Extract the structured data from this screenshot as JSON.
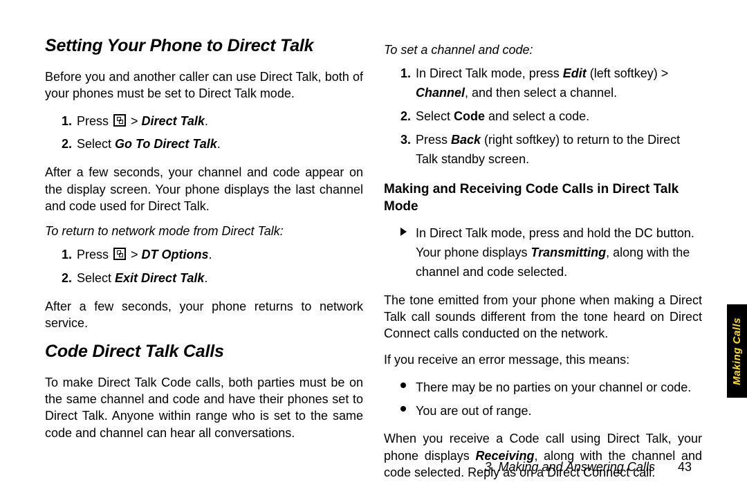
{
  "left": {
    "h1": "Setting Your Phone to Direct Talk",
    "p1": "Before you and another caller can use Direct Talk, both of your phones must be set to Direct Talk mode.",
    "step1a_pre": "Press ",
    "step1a_post": " >",
    "step1a_cmd": "Direct Talk",
    "step2a_pre": "Select ",
    "step2a_cmd": "Go To Direct Talk",
    "p2": "After a few seconds, your channel and code appear on the display screen. Your phone displays the last channel and code used for Direct Talk.",
    "sub1": "To return to network mode from Direct Talk:",
    "step1b_pre": "Press ",
    "step1b_post": " >",
    "step1b_cmd": "DT Options",
    "step2b_pre": "Select ",
    "step2b_cmd": "Exit Direct Talk",
    "p3": "After a few seconds, your phone returns to network service.",
    "h2": "Code Direct Talk Calls",
    "p4": "To make Direct Talk Code calls, both parties must be on the same channel and code and have their phones set to Direct Talk. Anyone within range who is set to the same code and channel can hear all conversations."
  },
  "right": {
    "sub1": "To set a channel and code:",
    "r1_pre": "In Direct Talk mode, press ",
    "r1_edit": "Edit",
    "r1_mid": " (left softkey) > ",
    "r1_chan": "Channel",
    "r1_post": ", and then select a channel.",
    "r2_pre": "Select ",
    "r2_code": "Code",
    "r2_post": " and select a code.",
    "r3_pre": "Press ",
    "r3_back": "Back",
    "r3_post": " (right softkey) to return to the Direct Talk standby screen.",
    "h3": "Making and Receiving Code Calls in Direct Talk Mode",
    "b1a": "In Direct Talk mode, press and hold the DC button. Your phone displays ",
    "b1b": "Transmitting",
    "b1c": ", along with the channel and code selected.",
    "p5": "The tone emitted from your phone when making a Direct Talk call sounds different from the tone heard on Direct Connect calls conducted on the network.",
    "p6": "If you receive an error message, this means:",
    "b2": "There may be no parties on your channel or code.",
    "b3": "You are out of range.",
    "p7a": "When you receive a Code call using Direct Talk, your phone displays ",
    "p7b": "Receiving",
    "p7c": ", along with the channel and code selected. Reply as on a Direct Connect call."
  },
  "sideTab": "Making Calls",
  "footer": {
    "section": "3. Making and Answering Calls",
    "page": "43"
  }
}
